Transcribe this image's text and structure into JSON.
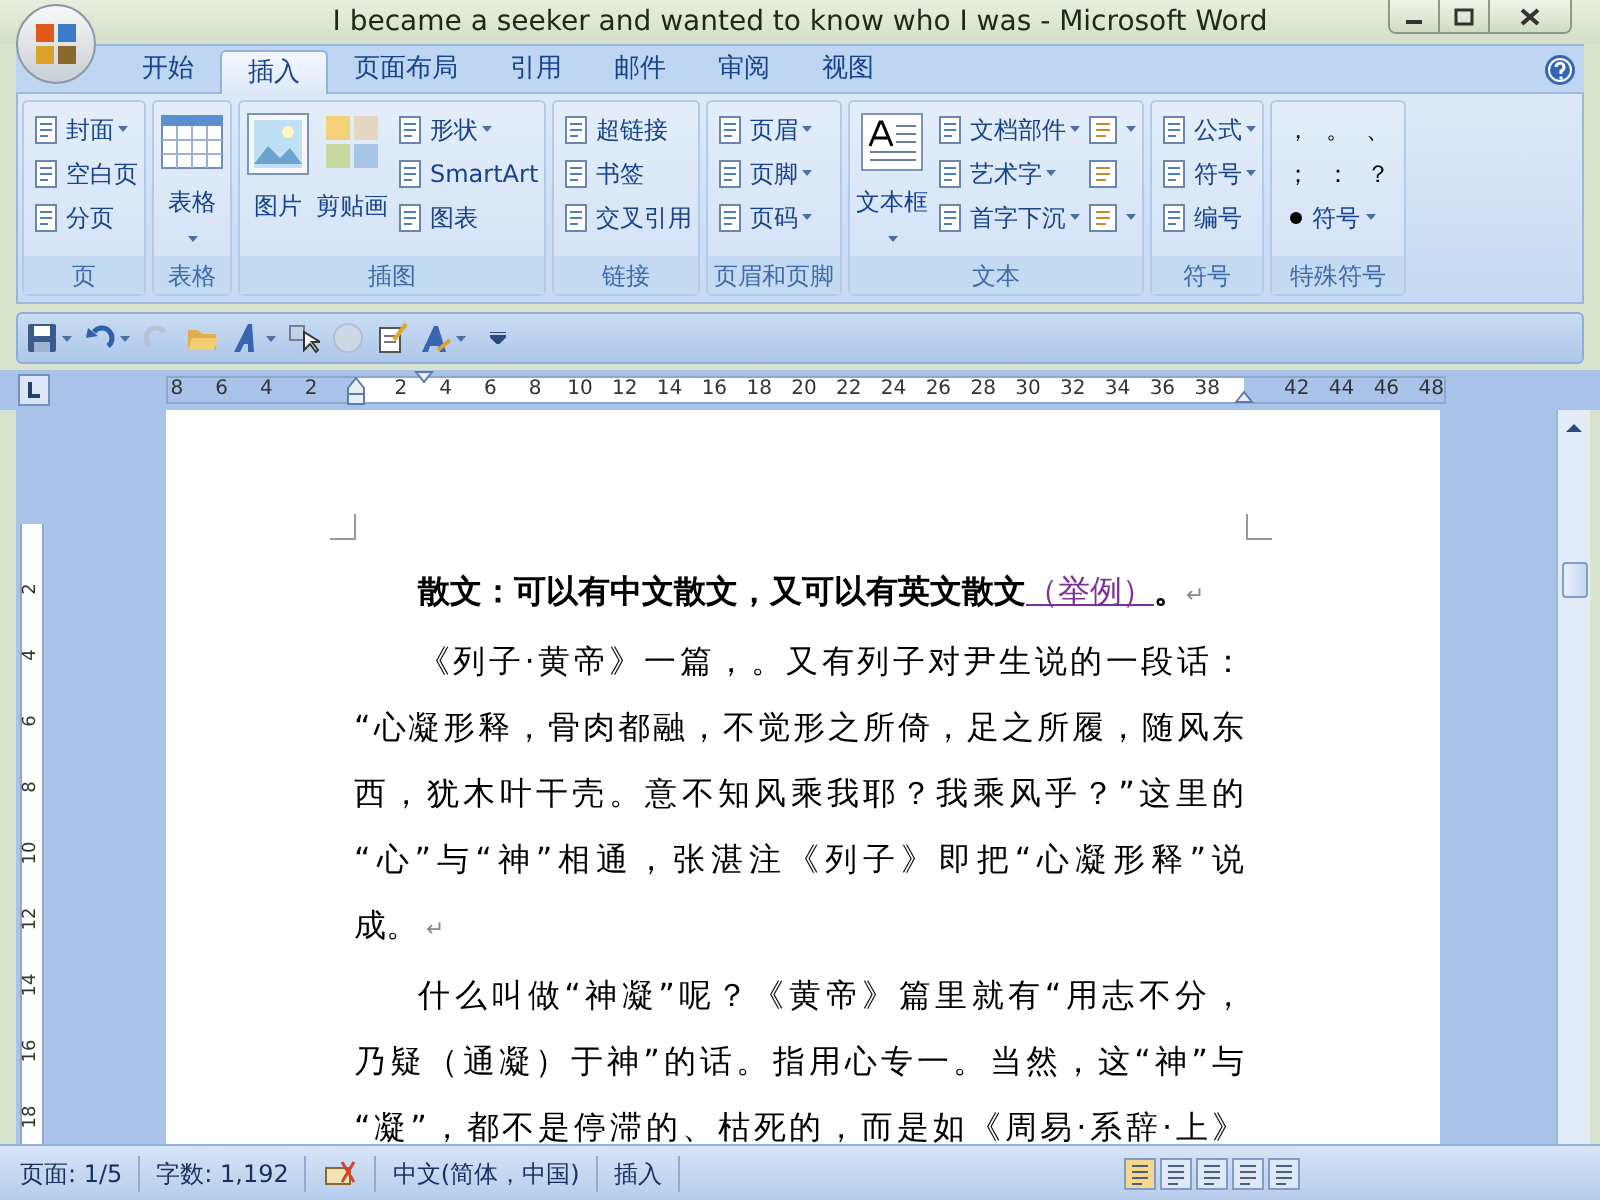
{
  "window": {
    "title": "I became a seeker and wanted to know who I was - Microsoft Word"
  },
  "tabs": [
    {
      "label": "开始",
      "selected": false
    },
    {
      "label": "插入",
      "selected": true
    },
    {
      "label": "页面布局",
      "selected": false
    },
    {
      "label": "引用",
      "selected": false
    },
    {
      "label": "邮件",
      "selected": false
    },
    {
      "label": "审阅",
      "selected": false
    },
    {
      "label": "视图",
      "selected": false
    }
  ],
  "ribbon": {
    "groups": [
      {
        "label": "页",
        "items": [
          {
            "kind": "small",
            "label": "封面",
            "dropdown": true
          },
          {
            "kind": "small",
            "label": "空白页",
            "dropdown": false
          },
          {
            "kind": "small",
            "label": "分页",
            "dropdown": false
          }
        ]
      },
      {
        "label": "表格",
        "items": [
          {
            "kind": "large",
            "label": "表格",
            "dropdown": true
          }
        ]
      },
      {
        "label": "插图",
        "items": [
          {
            "kind": "large",
            "label": "图片",
            "dropdown": false
          },
          {
            "kind": "large",
            "label": "剪贴画",
            "dropdown": false
          },
          {
            "kind": "small",
            "label": "形状",
            "dropdown": true
          },
          {
            "kind": "small",
            "label": "SmartArt",
            "dropdown": false
          },
          {
            "kind": "small",
            "label": "图表",
            "dropdown": false
          }
        ]
      },
      {
        "label": "链接",
        "items": [
          {
            "kind": "small",
            "label": "超链接",
            "dropdown": false
          },
          {
            "kind": "small",
            "label": "书签",
            "dropdown": false
          },
          {
            "kind": "small",
            "label": "交叉引用",
            "dropdown": false
          }
        ]
      },
      {
        "label": "页眉和页脚",
        "items": [
          {
            "kind": "small",
            "label": "页眉",
            "dropdown": true
          },
          {
            "kind": "small",
            "label": "页脚",
            "dropdown": true
          },
          {
            "kind": "small",
            "label": "页码",
            "dropdown": true
          }
        ]
      },
      {
        "label": "文本",
        "items": [
          {
            "kind": "large",
            "label": "文本框",
            "dropdown": true
          },
          {
            "kind": "small",
            "label": "文档部件",
            "dropdown": true
          },
          {
            "kind": "small",
            "label": "艺术字",
            "dropdown": true
          },
          {
            "kind": "small",
            "label": "首字下沉",
            "dropdown": true
          },
          {
            "kind": "icon",
            "dropdown": true
          },
          {
            "kind": "icon",
            "dropdown": false
          },
          {
            "kind": "icon",
            "dropdown": true
          }
        ]
      },
      {
        "label": "符号",
        "items": [
          {
            "kind": "small",
            "label": "公式",
            "dropdown": true
          },
          {
            "kind": "small",
            "label": "符号",
            "dropdown": true
          },
          {
            "kind": "small",
            "label": "编号",
            "dropdown": false
          }
        ]
      },
      {
        "label": "特殊符号",
        "items": [
          {
            "kind": "symbol",
            "label": "，"
          },
          {
            "kind": "symbol",
            "label": "。"
          },
          {
            "kind": "symbol",
            "label": "、"
          },
          {
            "kind": "symbol",
            "label": "；"
          },
          {
            "kind": "symbol",
            "label": "："
          },
          {
            "kind": "symbol",
            "label": "？"
          },
          {
            "kind": "small",
            "label": "符号",
            "dropdown": true
          }
        ]
      }
    ]
  },
  "ruler": {
    "left_numbers": [
      "8",
      "6",
      "4",
      "2"
    ],
    "right_numbers": [
      "2",
      "4",
      "6",
      "8",
      "10",
      "12",
      "14",
      "16",
      "18",
      "20",
      "22",
      "24",
      "26",
      "28",
      "30",
      "32",
      "34",
      "36",
      "38"
    ],
    "outer_numbers": [
      "42",
      "44",
      "46",
      "48"
    ],
    "vertical_numbers": [
      "2",
      "4",
      "6",
      "8",
      "10",
      "12",
      "14",
      "16",
      "18"
    ]
  },
  "document": {
    "heading": {
      "text": "散文：可以有中文散文，又可以有英文散文",
      "link": "（举例）",
      "tail": "。",
      "end_mark": "↵"
    },
    "paragraphs": [
      {
        "lines": [
          "《列子·黄帝》一篇，。又有列子对尹生说的一段话：",
          "“心凝形释，骨肉都融，不觉形之所倚，足之所履，随风东",
          "西，犹木叶干壳。意不知风乘我耶？我乘风乎？”这里的",
          "“心”与“神”相通，张湛注《列子》即把“心凝形释”说",
          "成。"
        ],
        "end_mark": "↵"
      },
      {
        "lines": [
          "什么叫做“神凝”呢？《黄帝》篇里就有“用志不分，",
          "乃疑（通凝）于神”的话。指用心专一。当然，这“神”与",
          "“凝”，都不是停滞的、枯死的，而是如《周易·系辞·上》"
        ]
      }
    ]
  },
  "status_bar": {
    "page": "页面: 1/5",
    "words": "字数: 1,192",
    "language": "中文(简体，中国)",
    "mode": "插入"
  }
}
